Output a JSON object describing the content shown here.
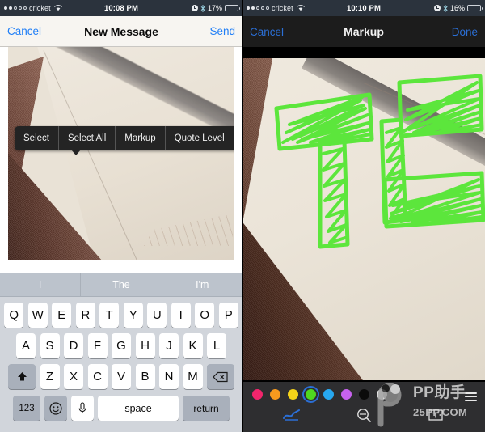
{
  "left_pane": {
    "status_bar": {
      "signal_dots_filled": 2,
      "signal_dots_total": 5,
      "carrier": "cricket",
      "wifi_icon": "wifi-icon",
      "time": "10:08 PM",
      "alarm_icon": "alarm-clock-icon",
      "bluetooth_icon": "bluetooth-icon",
      "battery_percent": "17%",
      "battery_level": 17,
      "battery_color": "#e0342a"
    },
    "nav": {
      "cancel_label": "Cancel",
      "title": "New Message",
      "send_label": "Send",
      "tint_color": "#1f7ef6"
    },
    "callout_menu": {
      "items": [
        {
          "label": "Select",
          "name": "callout-select"
        },
        {
          "label": "Select All",
          "name": "callout-select-all"
        },
        {
          "label": "Markup",
          "name": "callout-markup"
        },
        {
          "label": "Quote Level",
          "name": "callout-quote-level"
        },
        {
          "label": "▶",
          "name": "callout-more-arrow"
        }
      ]
    },
    "keyboard": {
      "predictive": [
        "I",
        "The",
        "I'm"
      ],
      "row1": [
        "Q",
        "W",
        "E",
        "R",
        "T",
        "Y",
        "U",
        "I",
        "O",
        "P"
      ],
      "row2": [
        "A",
        "S",
        "D",
        "F",
        "G",
        "H",
        "J",
        "K",
        "L"
      ],
      "row3": [
        "Z",
        "X",
        "C",
        "V",
        "B",
        "N",
        "M"
      ],
      "shift_icon": "shift-arrow-icon",
      "backspace_icon": "backspace-icon",
      "numbers_label": "123",
      "emoji_icon": "emoji-smiley-icon",
      "mic_icon": "microphone-icon",
      "space_label": "space",
      "return_label": "return"
    }
  },
  "right_pane": {
    "status_bar": {
      "signal_dots_filled": 2,
      "signal_dots_total": 5,
      "carrier": "cricket",
      "wifi_icon": "wifi-icon",
      "time": "10:10 PM",
      "alarm_icon": "alarm-clock-icon",
      "bluetooth_icon": "bluetooth-icon",
      "battery_percent": "16%",
      "battery_level": 16,
      "battery_color": "#e0342a"
    },
    "nav": {
      "cancel_label": "Cancel",
      "title": "Markup",
      "done_label": "Done",
      "tint_color": "#2b6fd6"
    },
    "annotation": {
      "ink_color": "#5ce63c",
      "drawn_text": "TL"
    },
    "toolbar": {
      "colors": [
        {
          "name": "swatch-pink",
          "hex": "#f2256c",
          "selected": false
        },
        {
          "name": "swatch-orange",
          "hex": "#f79a1e",
          "selected": false
        },
        {
          "name": "swatch-yellow",
          "hex": "#f6d419",
          "selected": false
        },
        {
          "name": "swatch-green",
          "hex": "#4fd91e",
          "selected": true
        },
        {
          "name": "swatch-blue",
          "hex": "#27a8f0",
          "selected": false
        },
        {
          "name": "swatch-purple",
          "hex": "#c862ef",
          "selected": false
        },
        {
          "name": "swatch-black",
          "hex": "#0b0b0b",
          "selected": false
        },
        {
          "name": "swatch-white",
          "hex": "#ffffff",
          "selected": false
        }
      ],
      "tools": [
        {
          "name": "pen-tool",
          "icon": "signature-pen-icon",
          "selected": true
        },
        {
          "name": "magnifier-tool",
          "icon": "loupe-magnifier-icon",
          "selected": false
        },
        {
          "name": "text-tool",
          "icon": "text-box-icon",
          "selected": false
        }
      ],
      "line_weight_icon": "line-weight-menu-icon"
    }
  },
  "watermark": {
    "title": "PP助手",
    "url": "25PP.COM",
    "logo_icon": "panda-logo-icon"
  }
}
